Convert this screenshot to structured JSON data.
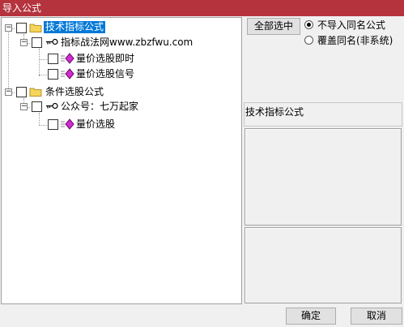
{
  "window": {
    "title": "导入公式"
  },
  "tree": {
    "nodes": [
      {
        "label": "技术指标公式"
      },
      {
        "label": "指标战法网www.zbzfwu.com"
      },
      {
        "label": "量价选股即时"
      },
      {
        "label": "量价选股信号"
      },
      {
        "label": "条件选股公式"
      },
      {
        "label": "公众号：七万起家"
      },
      {
        "label": "量价选股"
      }
    ]
  },
  "options": {
    "select_all_label": "全部选中",
    "radio_skip_label": "不导入同名公式",
    "radio_overwrite_label": "覆盖同名(非系统)"
  },
  "info": {
    "category_label": "技术指标公式"
  },
  "footer": {
    "ok_label": "确定",
    "cancel_label": "取消"
  }
}
